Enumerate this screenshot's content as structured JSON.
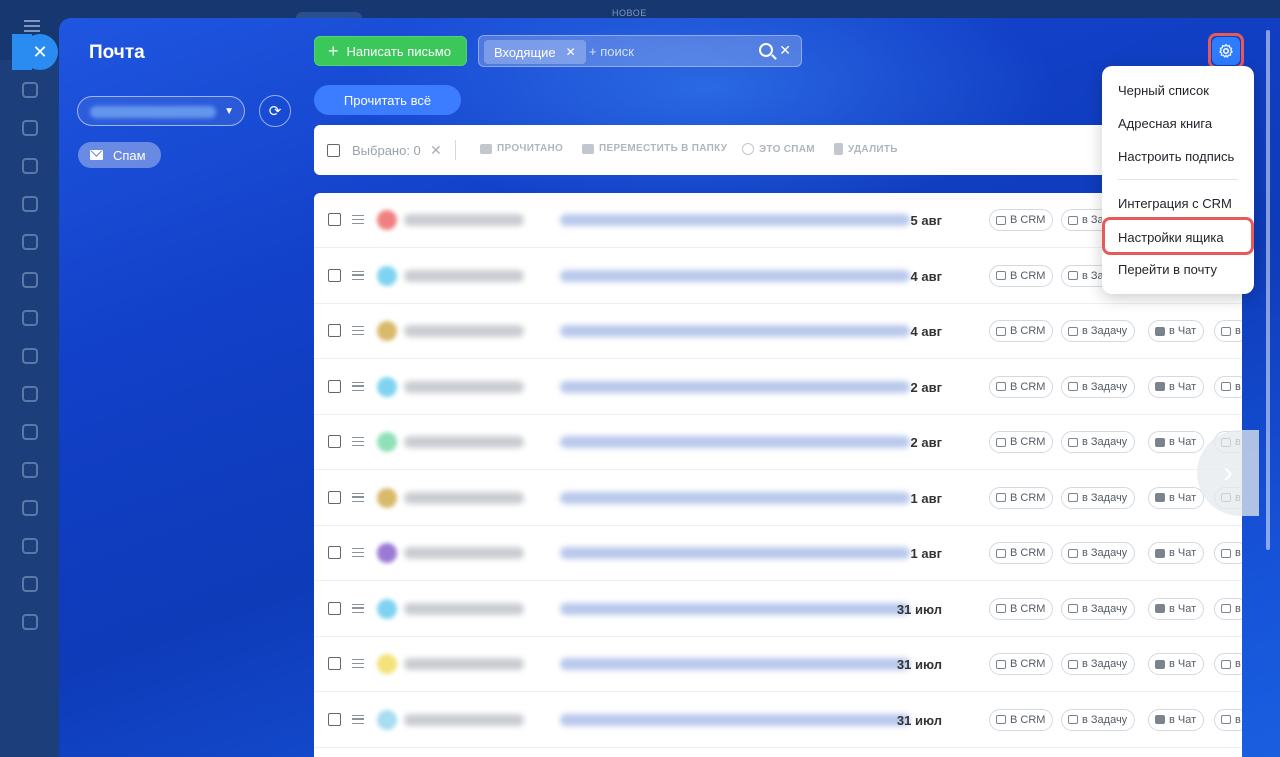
{
  "background": {
    "top_label": "НОВОЕ"
  },
  "panel": {
    "title": "Почта",
    "spam_label": "Спам"
  },
  "header": {
    "compose_label": "Написать письмо",
    "filter_chip": "Входящие",
    "search_placeholder": "+ поиск",
    "read_all_label": "Прочитать всё"
  },
  "toolbar": {
    "selected_label": "Выбрано: 0",
    "actions": [
      "ПРОЧИТАНО",
      "ПЕРЕМЕСТИТЬ В ПАПКУ",
      "ЭТО СПАМ",
      "УДАЛИТЬ"
    ]
  },
  "list": {
    "rows": [
      {
        "date": "5 авг",
        "avatar_color": "#f08080"
      },
      {
        "date": "4 авг",
        "avatar_color": "#7fd3f0"
      },
      {
        "date": "4 авг",
        "avatar_color": "#d9b96a"
      },
      {
        "date": "2 авг",
        "avatar_color": "#7fd3f0"
      },
      {
        "date": "2 авг",
        "avatar_color": "#8fe0b8"
      },
      {
        "date": "1 авг",
        "avatar_color": "#d9b96a"
      },
      {
        "date": "1 авг",
        "avatar_color": "#9b7ad6"
      },
      {
        "date": "31 июл",
        "avatar_color": "#7fd3f0"
      },
      {
        "date": "31 июл",
        "avatar_color": "#f3e27a"
      },
      {
        "date": "31 июл",
        "avatar_color": "#a8dcf0"
      }
    ],
    "actions": {
      "crm": "В CRM",
      "task": "в Задачу",
      "chat": "в Чат",
      "more": "в"
    }
  },
  "menu": {
    "items": [
      "Черный список",
      "Адресная книга",
      "Настроить подпись",
      "Интеграция с CRM",
      "Настройки ящика",
      "Перейти в почту"
    ]
  },
  "colors": {
    "accent": "#2e7dff",
    "compose": "#3bc85b",
    "highlight": "#e85a5a"
  }
}
